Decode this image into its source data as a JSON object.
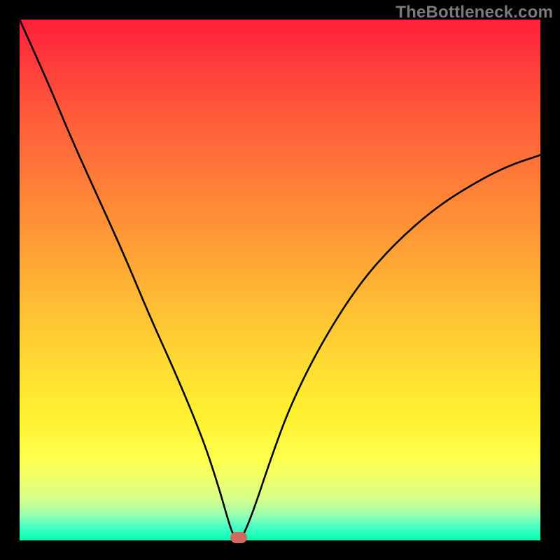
{
  "attribution": "TheBottleneck.com",
  "chart_data": {
    "type": "line",
    "title": "",
    "xlabel": "",
    "ylabel": "",
    "xlim": [
      0,
      100
    ],
    "ylim": [
      0,
      100
    ],
    "grid": false,
    "series": [
      {
        "name": "curve",
        "x": [
          0,
          5,
          10,
          15,
          20,
          25,
          30,
          35,
          38,
          40,
          41,
          42,
          43,
          45,
          48,
          52,
          58,
          65,
          72,
          80,
          88,
          94,
          100
        ],
        "y": [
          100,
          89,
          77,
          66,
          55,
          43,
          32,
          20,
          11,
          4,
          1,
          0,
          1,
          6,
          15,
          26,
          38,
          49,
          57,
          64,
          69,
          72,
          74
        ]
      }
    ],
    "marker": {
      "x": 42,
      "y": 0
    },
    "gradient_stops": [
      {
        "pos": 0,
        "color": "#ff1f3a"
      },
      {
        "pos": 0.5,
        "color": "#ffbb34"
      },
      {
        "pos": 0.85,
        "color": "#fdff4a"
      },
      {
        "pos": 1.0,
        "color": "#00ffb3"
      }
    ]
  }
}
